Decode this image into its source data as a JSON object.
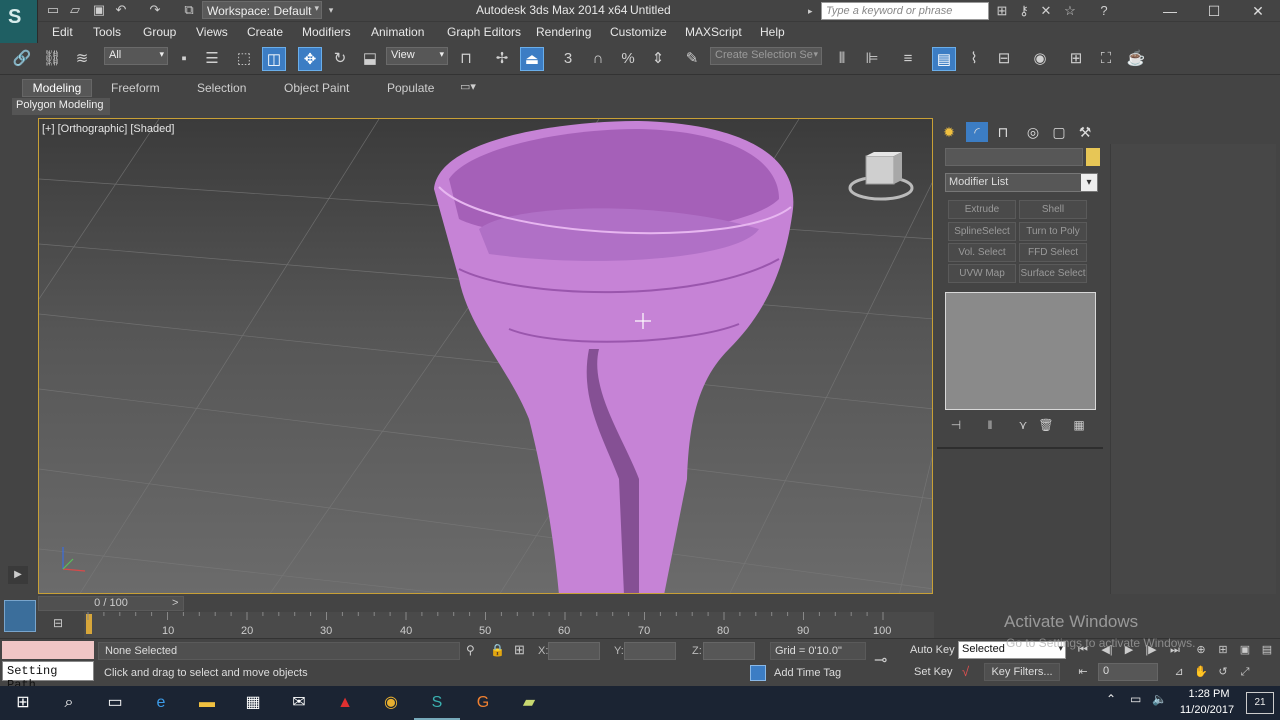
{
  "window": {
    "app_title": "Autodesk 3ds Max  2014 x64",
    "doc_title": "Untitled",
    "workspace": "Workspace: Default",
    "search_placeholder": "Type a keyword or phrase",
    "controls": {
      "minimize": "—",
      "maximize": "☐",
      "close": "✕"
    }
  },
  "menu": [
    "Edit",
    "Tools",
    "Group",
    "Views",
    "Create",
    "Modifiers",
    "Animation",
    "Graph Editors",
    "Rendering",
    "Customize",
    "MAXScript",
    "Help"
  ],
  "toolbar": {
    "selection_filter": "All",
    "reference_coord": "View",
    "named_selection": "Create Selection Se",
    "icons": [
      "link-icon",
      "unlink-icon",
      "bind-spacewarp-icon",
      "select-object-icon",
      "select-by-name-icon",
      "rect-region-icon",
      "window-crossing-icon",
      "select-move-icon",
      "select-rotate-icon",
      "select-scale-icon",
      "pivot-center-icon",
      "select-manipulate-icon",
      "snaps-toggle-icon",
      "angle-snap-icon",
      "percent-snap-icon",
      "spinner-snap-icon",
      "edit-named-sel-icon",
      "mirror-icon",
      "align-icon",
      "layer-manager-icon",
      "scene-explorer-icon",
      "curve-editor-icon",
      "schematic-view-icon",
      "material-editor-icon",
      "render-setup-icon",
      "rendered-frame-icon",
      "render-production-icon"
    ]
  },
  "ribbon": {
    "tabs": [
      "Modeling",
      "Freeform",
      "Selection",
      "Object Paint",
      "Populate"
    ],
    "active_tab": "Modeling",
    "panel_label": "Polygon Modeling"
  },
  "viewport": {
    "label": "[+] [Orthographic] [Shaded]",
    "object_color": "#c683d6",
    "border_color": "#c8a036"
  },
  "command_panel": {
    "tabs": [
      "create-tab-icon",
      "modify-tab-icon",
      "hierarchy-tab-icon",
      "motion-tab-icon",
      "display-tab-icon",
      "utilities-tab-icon"
    ],
    "object_color": "#e7c656",
    "modifier_list": "Modifier List",
    "modifier_buttons": [
      "Extrude",
      "Shell",
      "SplineSelect",
      "Turn to Poly",
      "Vol. Select",
      "FFD Select",
      "UVW Map",
      "Surface Select"
    ],
    "stack_tools": [
      "pin-stack-icon",
      "show-end-result-icon",
      "make-unique-icon",
      "remove-modifier-icon",
      "configure-sets-icon"
    ]
  },
  "timeline": {
    "slider_label": "0 / 100",
    "prev": "<",
    "next": ">",
    "ticks": [
      "10",
      "20",
      "30",
      "40",
      "50",
      "60",
      "70",
      "80",
      "90",
      "100"
    ]
  },
  "status": {
    "selection": "None Selected",
    "prompt": "Click and drag to select and move objects",
    "setting_path": "Setting Path",
    "x_label": "X:",
    "y_label": "Y:",
    "z_label": "Z:",
    "grid": "Grid = 0'10.0\"",
    "add_time_tag": "Add Time Tag",
    "auto_key": "Auto Key",
    "set_key": "Set Key",
    "key_mode": "Selected",
    "key_filters": "Key Filters...",
    "current_frame": "0"
  },
  "watermark": {
    "line1": "Activate Windows",
    "line2": "Go to Settings to activate Windows."
  },
  "taskbar": {
    "time": "1:28 PM",
    "date": "11/20/2017",
    "notifications": "21"
  }
}
